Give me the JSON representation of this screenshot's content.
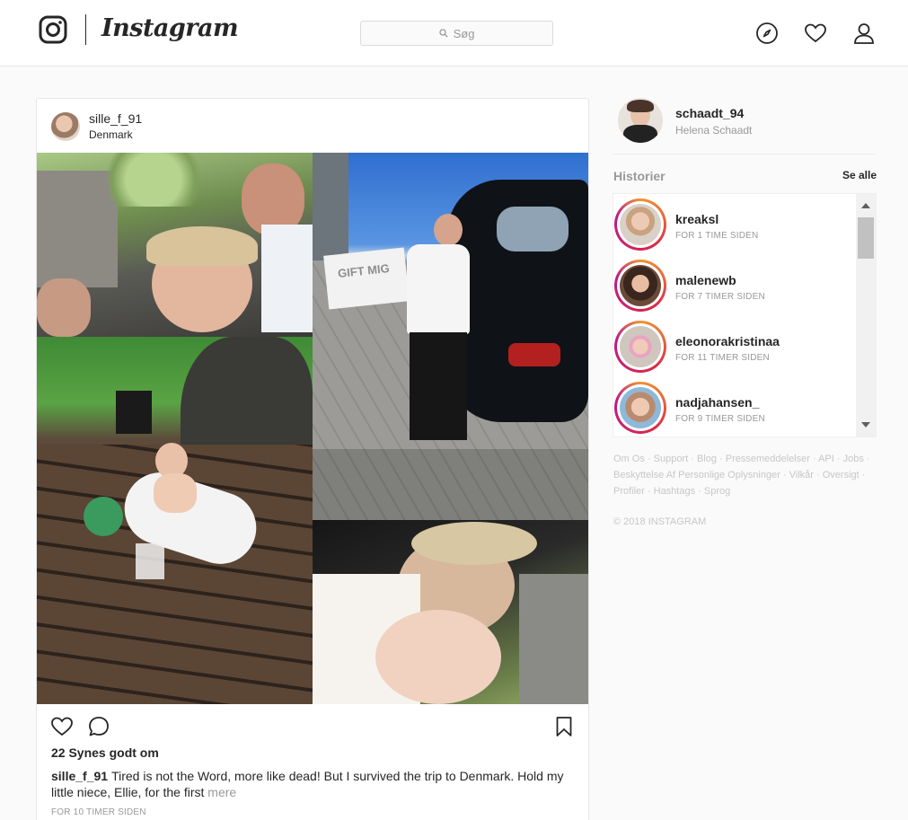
{
  "header": {
    "wordmark": "Instagram",
    "search_placeholder": "Søg"
  },
  "icons": {
    "logo": "instagram-camera-icon",
    "explore": "compass-icon",
    "activity": "heart-icon",
    "profile": "person-icon"
  },
  "post": {
    "username": "sille_f_91",
    "location": "Denmark",
    "likes": "22 Synes godt om",
    "caption_user": "sille_f_91",
    "caption_text": "Tired is not the Word, more like dead! But I survived the trip to Denmark. Hold my little niece, Ellie, for the first",
    "more_label": "mere",
    "timestamp": "FOR 10 TIMER SIDEN",
    "collage_sign": "GIFT MIG"
  },
  "sidebar": {
    "username": "schaadt_94",
    "full_name": "Helena Schaadt",
    "stories_title": "Historier",
    "see_all": "Se alle",
    "stories": [
      {
        "username": "kreaksl",
        "time": "FOR 1 TIME SIDEN"
      },
      {
        "username": "malenewb",
        "time": "FOR 7 TIMER SIDEN"
      },
      {
        "username": "eleonorakristinaa",
        "time": "FOR 11 TIMER SIDEN"
      },
      {
        "username": "nadjahansen_",
        "time": "FOR 9 TIMER SIDEN"
      }
    ],
    "footer_links": [
      "Om Os",
      "Support",
      "Blog",
      "Pressemeddelelser",
      "API",
      "Jobs",
      "Beskyttelse Af Personlige Oplysninger",
      "Vilkår",
      "Oversigt",
      "Profiler",
      "Hashtags",
      "Sprog"
    ],
    "copyright": "© 2018 INSTAGRAM"
  },
  "colors": {
    "border": "#e6e6e6",
    "muted_text": "#999999",
    "story_ring": "#dc2743"
  }
}
